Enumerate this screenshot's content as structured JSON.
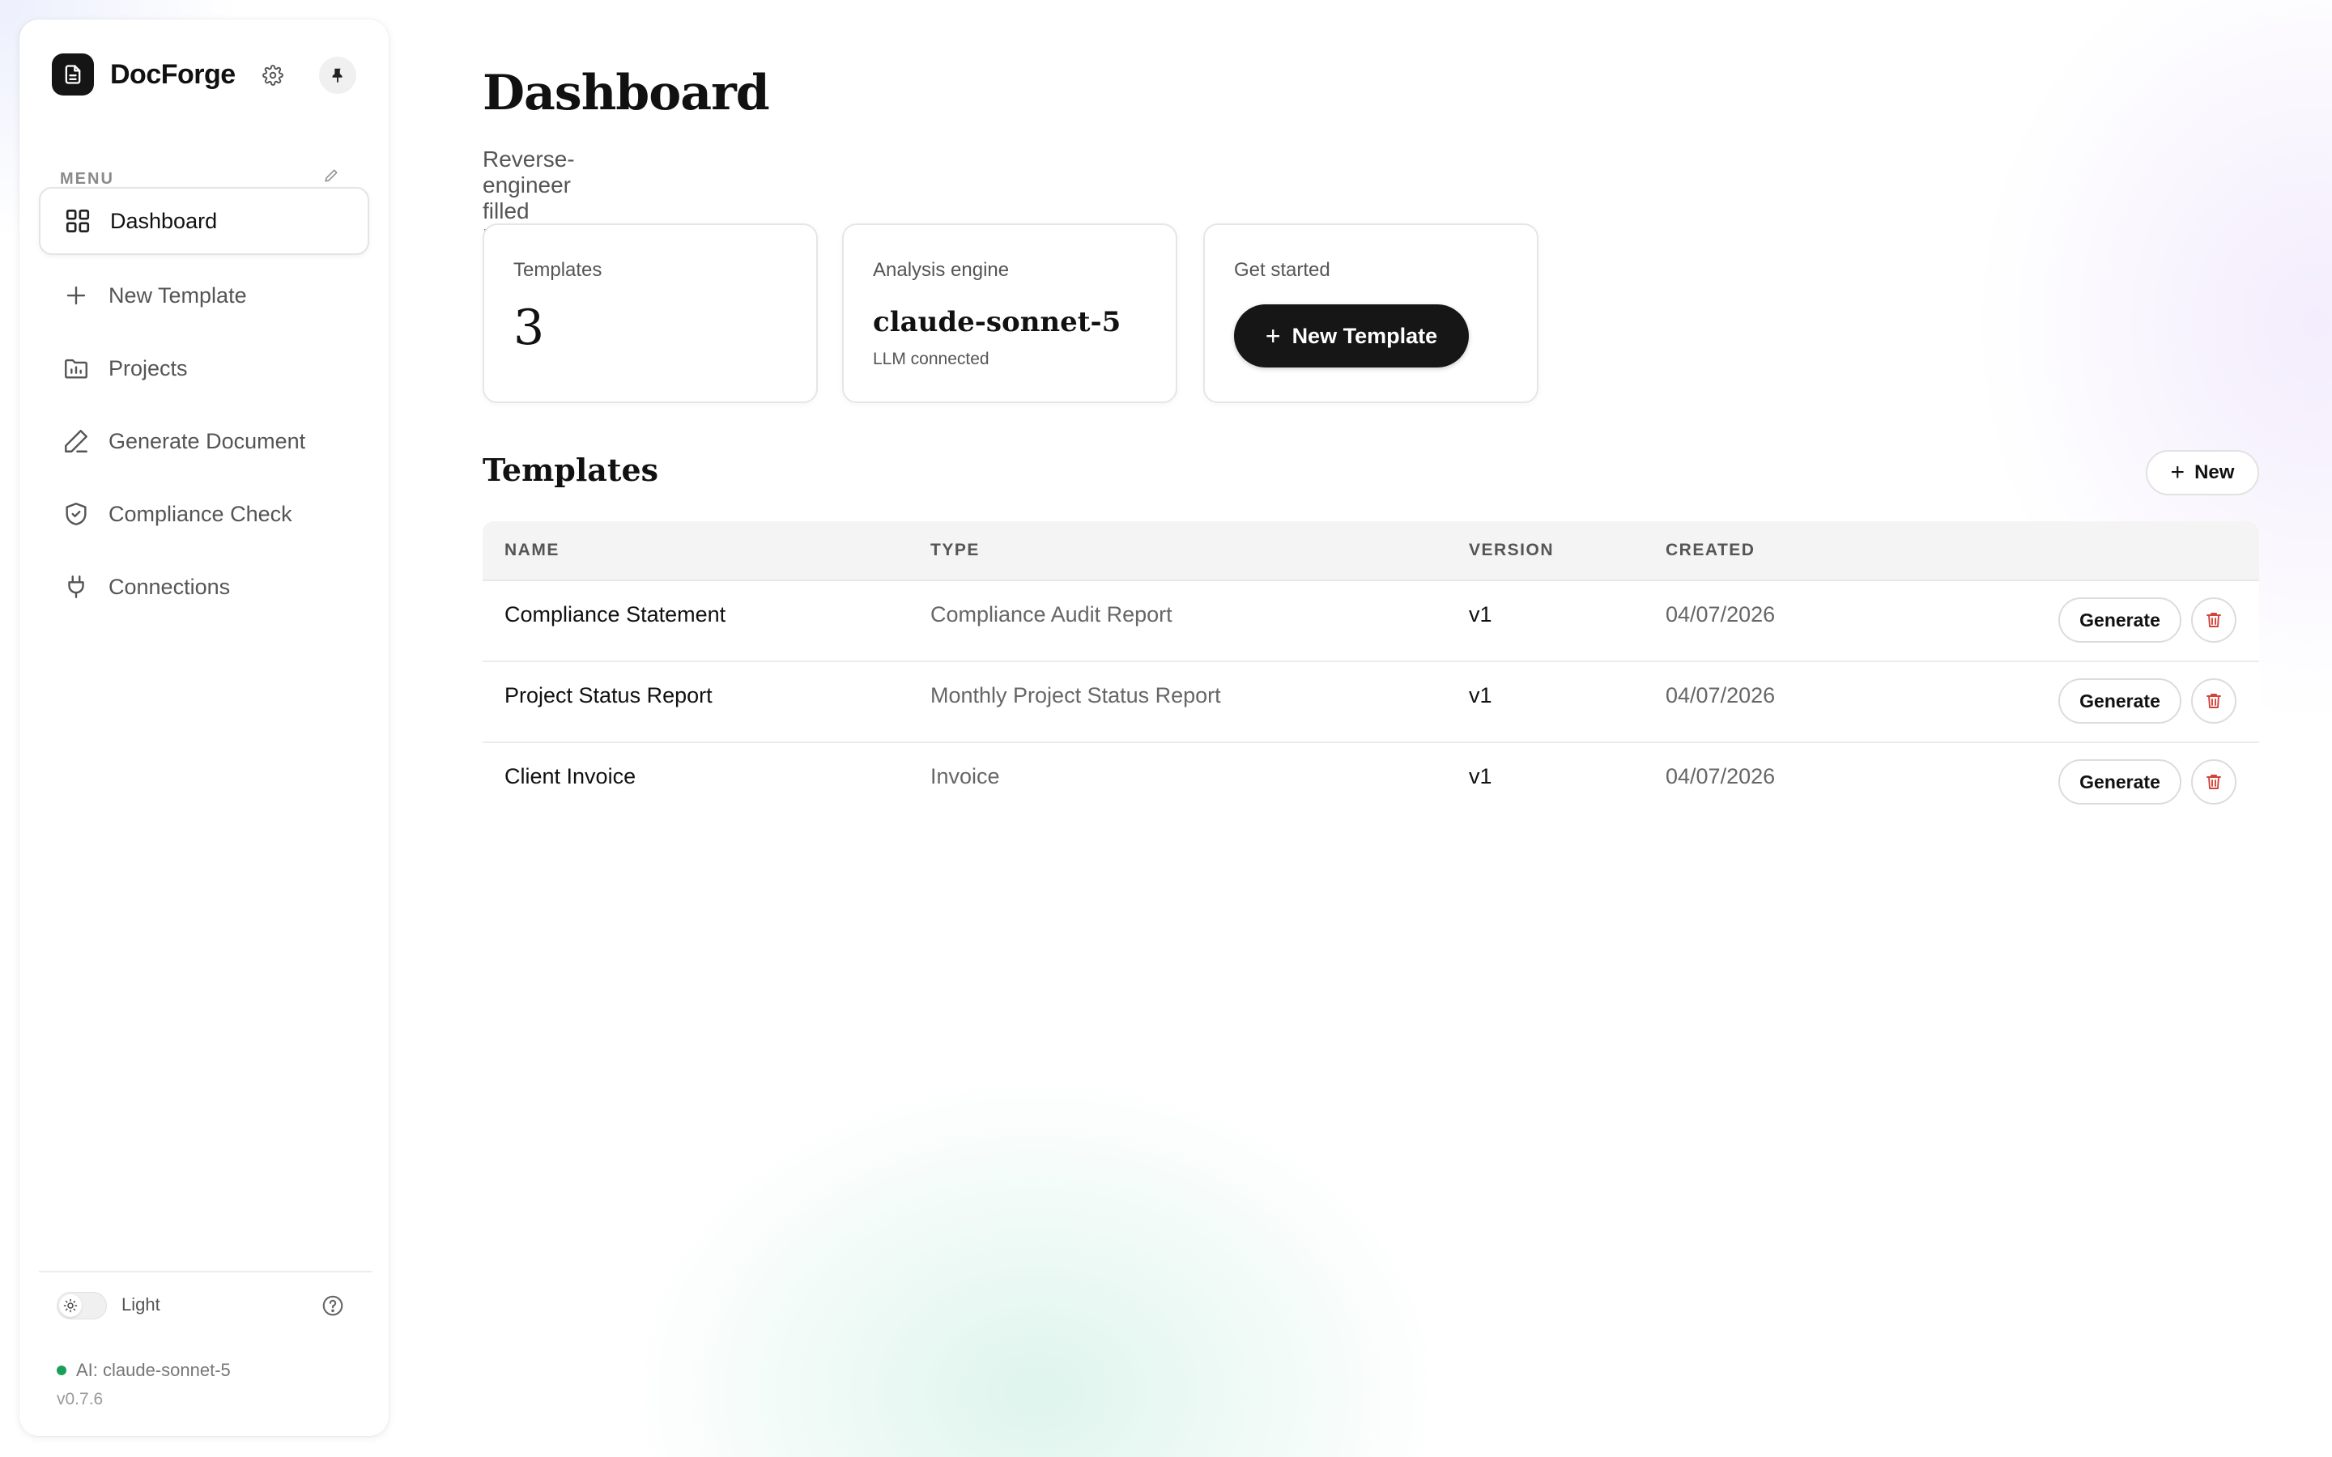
{
  "app": {
    "name": "DocForge",
    "icons": {
      "logo": "document-icon",
      "settings": "gear-icon",
      "pin": "pin-icon"
    }
  },
  "sidebar": {
    "menu_label": "MENU",
    "items": [
      {
        "label": "Dashboard",
        "icon": "grid-icon",
        "active": true
      },
      {
        "label": "New Template",
        "icon": "plus-icon",
        "active": false
      },
      {
        "label": "Projects",
        "icon": "folder-chart-icon",
        "active": false
      },
      {
        "label": "Generate Document",
        "icon": "pen-icon",
        "active": false
      },
      {
        "label": "Compliance Check",
        "icon": "shield-check-icon",
        "active": false
      },
      {
        "label": "Connections",
        "icon": "plug-icon",
        "active": false
      }
    ],
    "footer": {
      "theme_label": "Light",
      "ai_status": "AI: claude-sonnet-5",
      "version": "v0.7.6",
      "status_color": "#18a058"
    }
  },
  "main": {
    "title": "Dashboard",
    "subtitle": "Reverse-engineer filled DOCX files into reusable, AI-aware templates.",
    "cards": {
      "templates": {
        "label": "Templates",
        "value": "3"
      },
      "engine": {
        "label": "Analysis engine",
        "value": "claude-sonnet-5",
        "status": "LLM connected"
      },
      "get_started": {
        "label": "Get started",
        "button_label": "New Template"
      }
    },
    "templates_section": {
      "title": "Templates",
      "new_button_label": "New",
      "columns": [
        "NAME",
        "TYPE",
        "VERSION",
        "CREATED"
      ],
      "rows": [
        {
          "name": "Compliance Statement",
          "type": "Compliance Audit Report",
          "version": "v1",
          "created": "04/07/2026",
          "action": "Generate"
        },
        {
          "name": "Project Status Report",
          "type": "Monthly Project Status Report",
          "version": "v1",
          "created": "04/07/2026",
          "action": "Generate"
        },
        {
          "name": "Client Invoice",
          "type": "Invoice",
          "version": "v1",
          "created": "04/07/2026",
          "action": "Generate"
        }
      ]
    }
  },
  "colors": {
    "accent_dark": "#161616",
    "delete_red": "#d0443a"
  }
}
